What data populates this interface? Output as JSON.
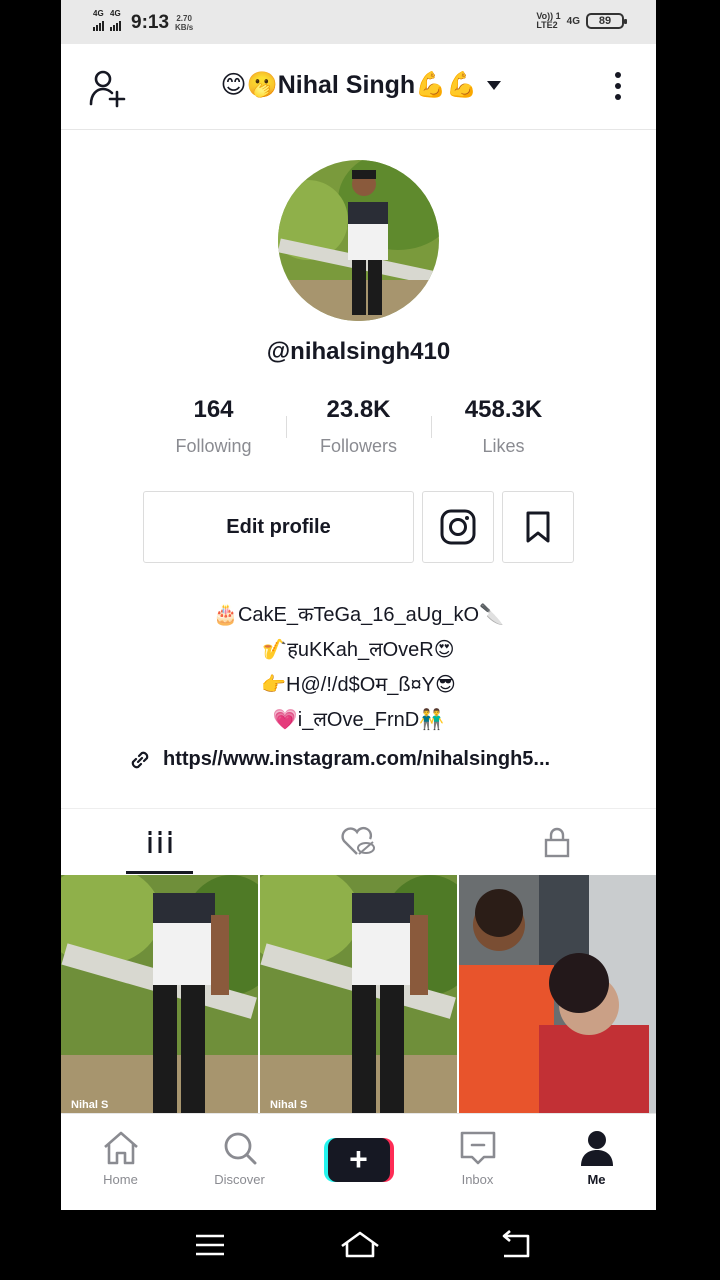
{
  "status_bar": {
    "signal1": "4G",
    "signal2": "4G",
    "time": "9:13",
    "speed_value": "2.70",
    "speed_unit": "KB/s",
    "volte": "Vo)) 1",
    "lte": "LTE2",
    "network": "4G",
    "battery": "89"
  },
  "header": {
    "title": "😊🫢Nihal Singh💪💪",
    "add_friend_icon": "add-user-icon",
    "more_icon": "more-vertical-icon"
  },
  "profile": {
    "username": "@nihalsingh410",
    "stats": [
      {
        "value": "164",
        "label": "Following"
      },
      {
        "value": "23.8K",
        "label": "Followers"
      },
      {
        "value": "458.3K",
        "label": "Likes"
      }
    ],
    "edit_label": "Edit profile",
    "bio": [
      "🎂CakE_कTeGa_16_aUg_kO🔪",
      "🎷हuKKah_लOveR😍",
      "👉H@/!/d$Oम_ß¤Y😎",
      "💗i_लOve_FrnD👬"
    ],
    "link": "https//www.instagram.com/nihalsingh5..."
  },
  "tabs": [
    {
      "icon": "videos-grid-icon",
      "active": true
    },
    {
      "icon": "liked-hidden-icon",
      "active": false
    },
    {
      "icon": "lock-icon",
      "active": false
    }
  ],
  "thumbnails": [
    {
      "watermark": "Nihal S"
    },
    {
      "watermark": "Nihal S"
    },
    {
      "watermark": ""
    }
  ],
  "tabbar": [
    {
      "label": "Home",
      "icon": "home-icon"
    },
    {
      "label": "Discover",
      "icon": "search-icon"
    },
    {
      "label": "",
      "icon": "create-icon"
    },
    {
      "label": "Inbox",
      "icon": "inbox-icon"
    },
    {
      "label": "Me",
      "icon": "profile-icon"
    }
  ],
  "colors": {
    "text": "#161823",
    "muted": "#8a8b91",
    "cyan": "#25f4ee",
    "red": "#fe2c55"
  }
}
